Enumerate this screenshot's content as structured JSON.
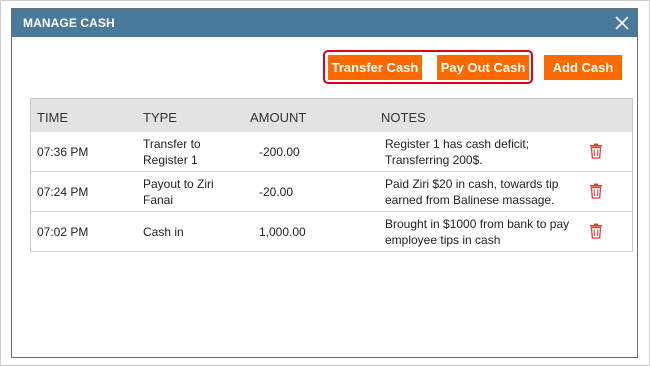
{
  "dialog": {
    "title": "MANAGE CASH"
  },
  "buttons": {
    "transfer_cash": "Transfer Cash",
    "pay_out_cash": "Pay Out Cash",
    "add_cash": "Add Cash"
  },
  "table": {
    "headers": {
      "time": "TIME",
      "type": "TYPE",
      "amount": "AMOUNT",
      "notes": "NOTES"
    },
    "rows": [
      {
        "time": "07:36 PM",
        "type_line1": "Transfer to",
        "type_line2": "Register 1",
        "amount": "-200.00",
        "notes_line1": "Register 1 has cash deficit;",
        "notes_line2": "Transferring 200$."
      },
      {
        "time": "07:24 PM",
        "type_line1": "Payout to Ziri",
        "type_line2": "Fanai",
        "amount": "-20.00",
        "notes_line1": "Paid Ziri $20 in cash, towards tip",
        "notes_line2": "earned from Balinese massage."
      },
      {
        "time": "07:02 PM",
        "type_line1": "Cash in",
        "type_line2": "",
        "amount": "1,000.00",
        "notes_line1": "Brought in $1000 from bank to pay",
        "notes_line2": "employee tips in cash"
      }
    ]
  },
  "icons": {
    "close": "close-icon",
    "delete": "trash-icon"
  },
  "colors": {
    "titlebar": "#4a7a9b",
    "button": "#ff6a00",
    "highlight": "#e0001a",
    "trash": "#e53935",
    "header_bg": "#e3e3e3"
  }
}
